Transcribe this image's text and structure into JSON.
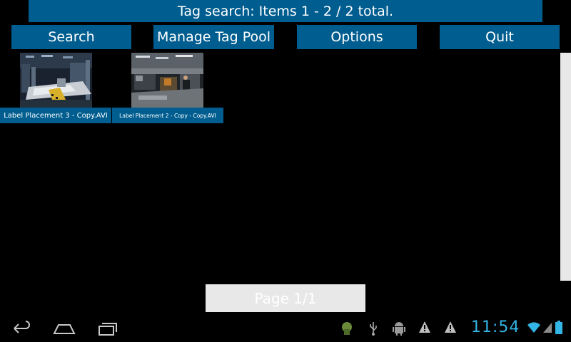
{
  "header": {
    "title": "Tag search: Items 1 - 2 / 2 total."
  },
  "toolbar": {
    "search_label": "Search",
    "manage_label": "Manage Tag Pool",
    "options_label": "Options",
    "quit_label": "Quit"
  },
  "results": [
    {
      "caption": "Label Placement 3 - Copy.AVI",
      "thumbnail_icon": "factory-video-thumbnail"
    },
    {
      "caption": "Label Placement 2 - Copy - Copy.AVI",
      "thumbnail_icon": "factory-video-thumbnail"
    }
  ],
  "pagination": {
    "label": "Page 1/1"
  },
  "system_bar": {
    "nav_icons": [
      "back-icon",
      "home-icon",
      "recent-apps-icon"
    ],
    "status_icons": [
      "android-debug-icon",
      "usb-icon",
      "android-icon",
      "warning-icon",
      "warning-icon",
      "wifi-icon",
      "signal-icon",
      "battery-icon"
    ],
    "clock": "11:54"
  },
  "colors": {
    "accent": "#005d8f",
    "background": "#000000",
    "page_indicator_bg": "#e8e8e8",
    "clock": "#33b5e5"
  }
}
